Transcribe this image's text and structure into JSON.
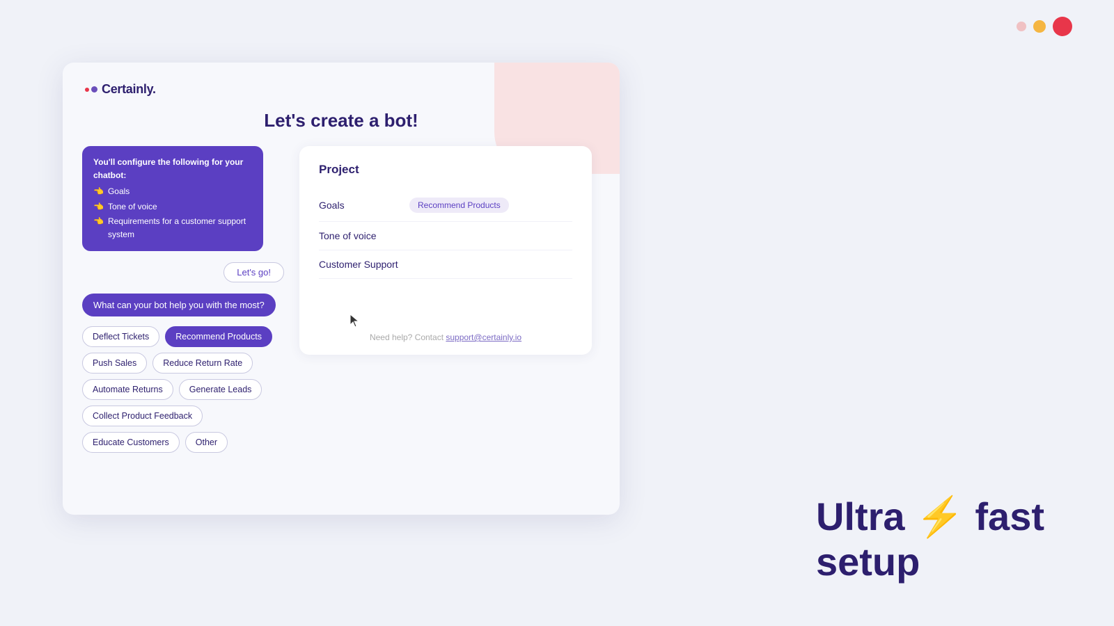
{
  "window": {
    "dots": [
      {
        "color": "#f0a0a0",
        "size": "small",
        "label": "minimize"
      },
      {
        "color": "#f5b642",
        "size": "medium",
        "label": "maximize"
      },
      {
        "color": "#e8364a",
        "size": "large",
        "label": "close"
      }
    ]
  },
  "logo": {
    "text": "Certainly."
  },
  "page": {
    "title": "Let's create a bot!"
  },
  "info_bubble": {
    "intro": "You'll configure the following for your chatbot:",
    "items": [
      {
        "emoji": "👈",
        "text": "Goals"
      },
      {
        "emoji": "👈",
        "text": "Tone of voice"
      },
      {
        "emoji": "👈",
        "text": "Requirements for a customer support system"
      }
    ]
  },
  "lets_go_button": "Let's go!",
  "question": "What can your bot help you with the most?",
  "choices": [
    {
      "label": "Deflect Tickets",
      "selected": false
    },
    {
      "label": "Recommend Products",
      "selected": true
    },
    {
      "label": "Push Sales",
      "selected": false
    },
    {
      "label": "Reduce Return Rate",
      "selected": false
    },
    {
      "label": "Automate Returns",
      "selected": false
    },
    {
      "label": "Generate Leads",
      "selected": false
    },
    {
      "label": "Collect Product Feedback",
      "selected": false
    },
    {
      "label": "Educate Customers",
      "selected": false
    },
    {
      "label": "Other",
      "selected": false
    }
  ],
  "project": {
    "title": "Project",
    "rows": [
      {
        "label": "Goals",
        "value": "Recommend Products"
      },
      {
        "label": "Tone of voice",
        "value": ""
      },
      {
        "label": "Customer Support",
        "value": ""
      }
    ]
  },
  "help": {
    "text": "Need help? Contact ",
    "link_text": "support@certainly.io",
    "link_href": "mailto:support@certainly.io"
  },
  "tagline": {
    "part1": "Ultra ",
    "lightning": "⚡",
    "part2": " fast",
    "part3": "setup"
  }
}
